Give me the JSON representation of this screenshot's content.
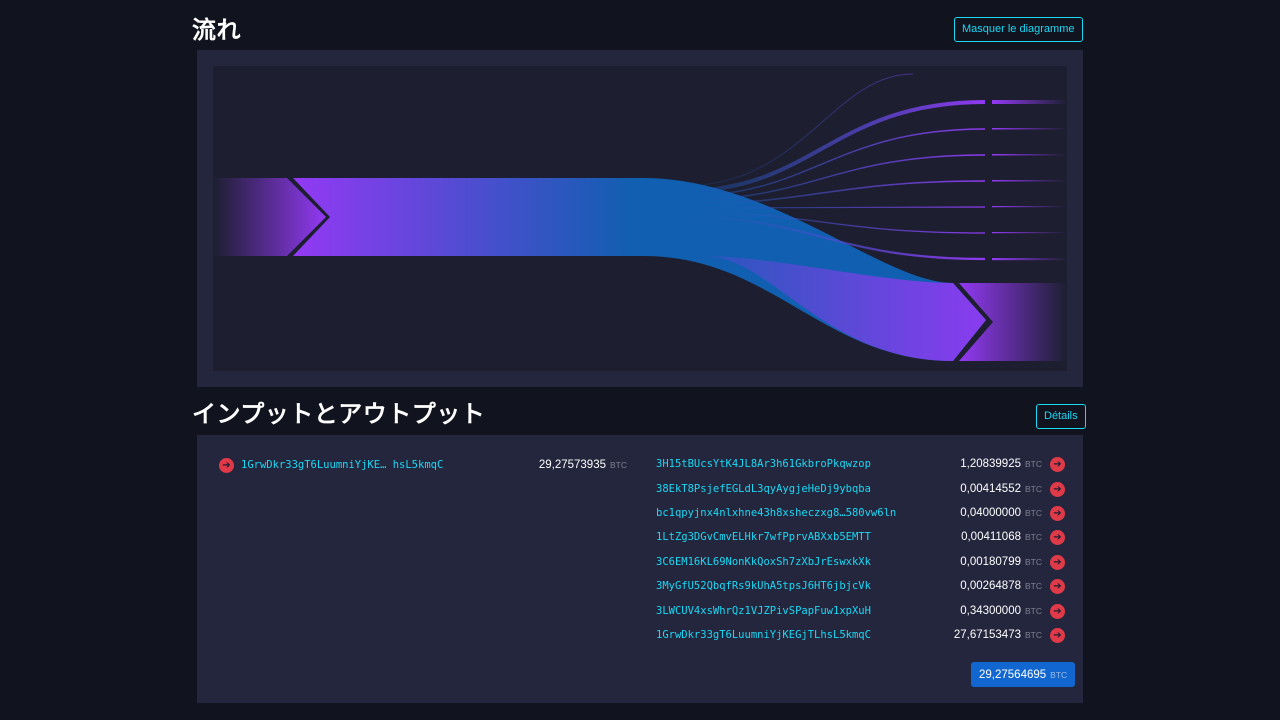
{
  "flow": {
    "title": "流れ",
    "hide_button": "Masquer le diagramme"
  },
  "io": {
    "title": "インプットとアウトプット",
    "details_button": "Détails",
    "unit": "BTC",
    "inputs": [
      {
        "address": "1GrwDkr33gT6LuumniYjKE… hsL5kmqC",
        "amount": "29,27573935"
      }
    ],
    "outputs": [
      {
        "address": "3H15tBUcsYtK4JL8Ar3h61GkbroPkqwzop",
        "amount": "1,20839925"
      },
      {
        "address": "38EkT8PsjefEGLdL3qyAygjeHeDj9ybqba",
        "amount": "0,00414552"
      },
      {
        "address": "bc1qpyjnx4nlxhne43h8xsheczxg8…580vw6ln",
        "amount": "0,04000000"
      },
      {
        "address": "1LtZg3DGvCmvELHkr7wfPprvABXxb5EMTT",
        "amount": "0,00411068"
      },
      {
        "address": "3C6EM16KL69NonKkQoxSh7zXbJrEswxkXk",
        "amount": "0,00180799"
      },
      {
        "address": "3MyGfU52QbqfRs9kUhA5tpsJ6HT6jbjcVk",
        "amount": "0,00264878"
      },
      {
        "address": "3LWCUV4xsWhrQz1VJZPivSPapFuw1xpXuH",
        "amount": "0,34300000"
      },
      {
        "address": "1GrwDkr33gT6LuumniYjKEGjTLhsL5kmqC",
        "amount": "27,67153473"
      }
    ],
    "total": "29,27564695"
  },
  "colors": {
    "accent": "#1bd8f4",
    "purple": "#9339f4",
    "blue": "#105fb0",
    "red_icon": "#e03a48",
    "badge": "#1167cf"
  },
  "icons": {
    "io_arrow": "arrow-right-circle-icon"
  }
}
